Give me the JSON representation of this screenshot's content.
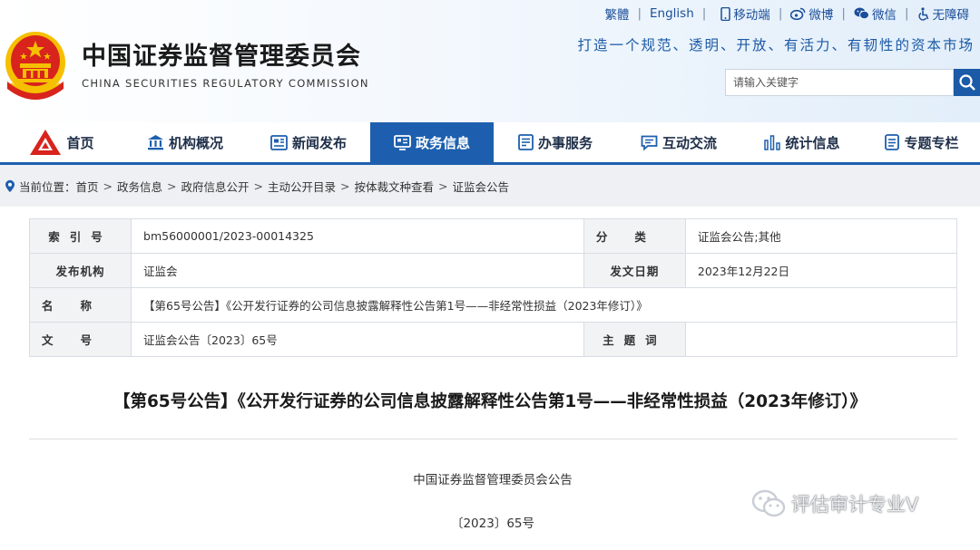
{
  "header": {
    "site_title": "中国证券监督管理委员会",
    "site_subtitle": "CHINA SECURITIES REGULATORY COMMISSION",
    "slogan": "打造一个规范、透明、开放、有活力、有韧性的资本市场",
    "top_links": {
      "traditional": "繁體",
      "english": "English",
      "mobile": "移动端",
      "weibo": "微博",
      "wechat": "微信",
      "accessibility": "无障碍"
    },
    "search_placeholder": "请输入关键字"
  },
  "nav": {
    "items": [
      {
        "label": "首页",
        "icon": "home-logo-icon"
      },
      {
        "label": "机构概况",
        "icon": "building-icon"
      },
      {
        "label": "新闻发布",
        "icon": "news-icon"
      },
      {
        "label": "政务信息",
        "icon": "government-info-icon",
        "active": true
      },
      {
        "label": "办事服务",
        "icon": "service-icon"
      },
      {
        "label": "互动交流",
        "icon": "chat-icon"
      },
      {
        "label": "统计信息",
        "icon": "statistics-icon"
      },
      {
        "label": "专题专栏",
        "icon": "topic-icon"
      }
    ]
  },
  "breadcrumb": {
    "prefix": "当前位置：",
    "items": [
      "首页",
      "政务信息",
      "政府信息公开",
      "主动公开目录",
      "按体裁文种查看",
      "证监会公告"
    ]
  },
  "info_table": {
    "index_label": "索引号",
    "index_value": "bm56000001/2023-00014325",
    "category_label": "分类",
    "category_value": "证监会公告;其他",
    "publisher_label": "发布机构",
    "publisher_value": "证监会",
    "date_label": "发文日期",
    "date_value": "2023年12月22日",
    "name_label": "名称",
    "name_value": "【第65号公告】《公开发行证券的公司信息披露解释性公告第1号——非经常性损益（2023年修订）》",
    "docno_label": "文号",
    "docno_value": "证监会公告〔2023〕65号",
    "keywords_label": "主题词",
    "keywords_value": ""
  },
  "article": {
    "title": "【第65号公告】《公开发行证券的公司信息披露解释性公告第1号——非经常性损益（2023年修订）》",
    "org": "中国证券监督管理委员会公告",
    "doc_number": "〔2023〕65号"
  },
  "watermark": "评估审计专业V",
  "colors": {
    "brand_blue": "#1d5fae",
    "emblem_red": "#d8241c",
    "emblem_gold": "#f5c000"
  }
}
